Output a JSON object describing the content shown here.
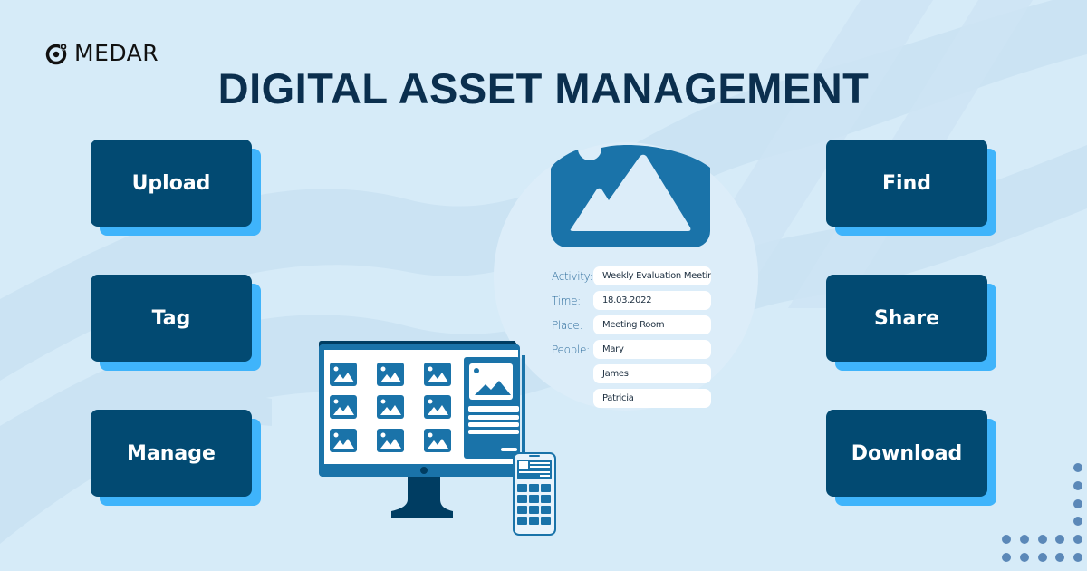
{
  "brand": {
    "logo_icon": "medar-logo-icon",
    "name": "MEDAR"
  },
  "title": "DIGITAL ASSET MANAGEMENT",
  "colors": {
    "background": "#d6ebf8",
    "button_face": "#024a72",
    "button_shadow": "#3fb4fb",
    "title": "#0b2f4e",
    "illustration_blue": "#1a73a9",
    "illustration_dark": "#003d62"
  },
  "left_actions": [
    {
      "label": "Upload"
    },
    {
      "label": "Tag"
    },
    {
      "label": "Manage"
    }
  ],
  "right_actions": [
    {
      "label": "Find"
    },
    {
      "label": "Share"
    },
    {
      "label": "Download"
    }
  ],
  "asset_card": {
    "image_icon": "image-mountain-icon",
    "fields": [
      {
        "label": "Activity:",
        "value": "Weekly Evaluation Meeting"
      },
      {
        "label": "Time:",
        "value": "18.03.2022"
      },
      {
        "label": "Place:",
        "value": "Meeting Room"
      },
      {
        "label": "People:",
        "value": "Mary"
      },
      {
        "label": "",
        "value": "James"
      },
      {
        "label": "",
        "value": "Patricia"
      }
    ]
  },
  "illustration": {
    "monitor_icon": "desktop-gallery-icon",
    "phone_icon": "mobile-gallery-icon"
  }
}
